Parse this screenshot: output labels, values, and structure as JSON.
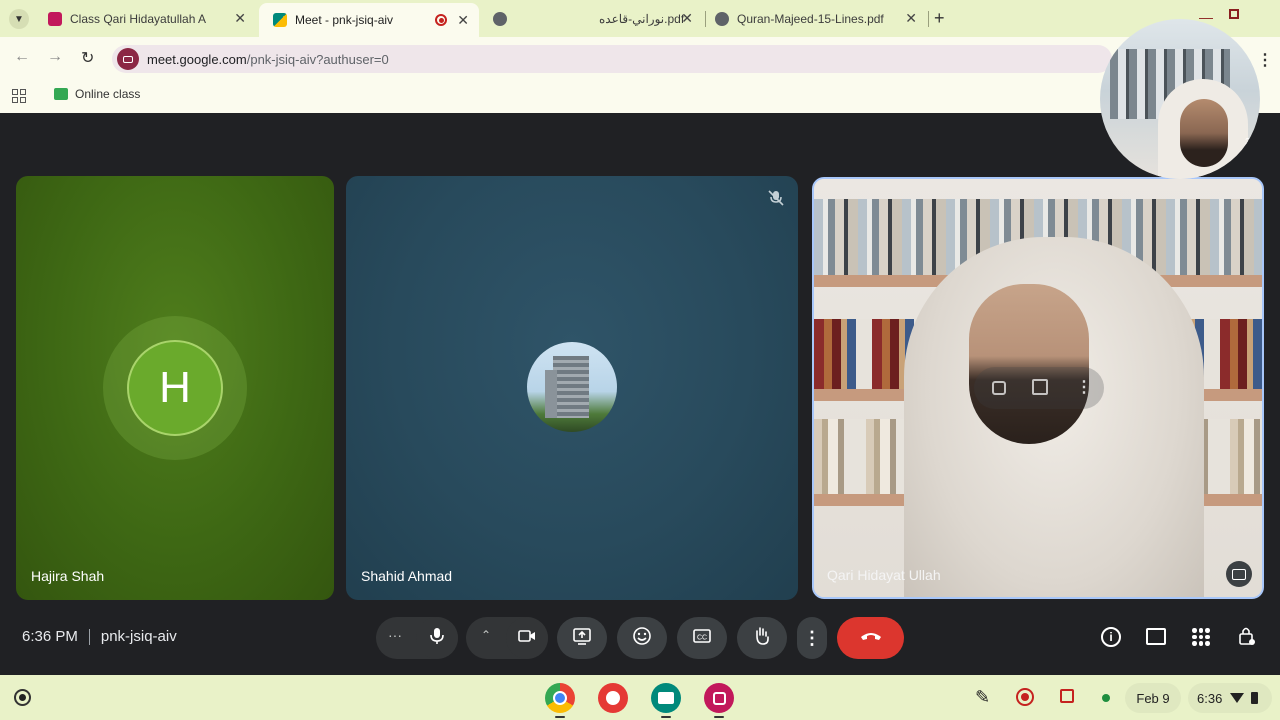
{
  "tabs": [
    {
      "title": "Class Qari Hidayatullah A",
      "color": "#c2185b"
    },
    {
      "title": "Meet - pnk-jsiq-aiv",
      "color": "#00897b"
    },
    {
      "title": "",
      "color": "#5f6368"
    },
    {
      "title": "نوراني-قاعده.pdf",
      "color": "#5f6368"
    },
    {
      "title": "Quran-Majeed-15-Lines.pdf",
      "color": "#5f6368"
    }
  ],
  "address": {
    "host": "meet.google.com",
    "path": "/pnk-jsiq-aiv?authuser=0"
  },
  "bookmarks": [
    {
      "label": "Online class"
    }
  ],
  "participants": [
    {
      "name": "Hajira Shah",
      "initial": "H"
    },
    {
      "name": "Shahid Ahmad"
    },
    {
      "name": "Qari Hidayat Ullah"
    }
  ],
  "self_view": {
    "count": "3"
  },
  "meeting": {
    "time": "6:36 PM",
    "code": "pnk-jsiq-aiv"
  },
  "shelf": {
    "date": "Feb 9",
    "time": "6:36"
  },
  "colors": {
    "accent_red": "#ea4335",
    "control_bg": "#3c4043",
    "tab_bg": "#e9f2c8"
  },
  "icons": [
    "tab-list-icon",
    "back-icon",
    "forward-icon",
    "reload-icon",
    "apps-icon",
    "mic-icon",
    "camera-icon",
    "present-icon",
    "emoji-icon",
    "captions-icon",
    "raise-hand-icon",
    "more-icon",
    "hang-up-icon",
    "info-icon",
    "chat-icon",
    "activities-icon",
    "host-controls-icon"
  ]
}
